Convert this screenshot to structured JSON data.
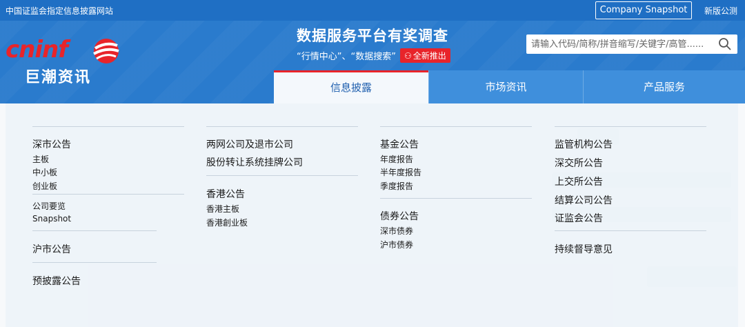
{
  "topbar": {
    "site_note": "中国证监会指定信息披露网站",
    "snapshot_label": "Company Snapshot",
    "new_announce": "新版公测"
  },
  "logo": {
    "word": "cninf",
    "sub": "巨潮资讯"
  },
  "promo": {
    "title": "数据服务平台有奖调查",
    "subtitle": "“行情中心”、“数据搜索”",
    "badge": "全新推出"
  },
  "search": {
    "placeholder": "请输入代码/简称/拼音缩写/关键字/高管......"
  },
  "nav": {
    "tabs": [
      {
        "label": "信息披露"
      },
      {
        "label": "市场资讯"
      },
      {
        "label": "产品服务"
      }
    ]
  },
  "menu": {
    "col1": {
      "shenshi": "深市公告",
      "items": [
        "主板",
        "中小板",
        "创业板"
      ],
      "items2": [
        "公司要览",
        "Snapshot"
      ],
      "hushi": "沪市公告",
      "yupilu": "预披露公告"
    },
    "col2": {
      "liangwang": "两网公司及退市公司",
      "gufen": "股份转让系统挂牌公司",
      "xianggang": "香港公告",
      "items": [
        "香港主板",
        "香港創业板"
      ]
    },
    "col3": {
      "jijin": "基金公告",
      "items": [
        "年度报告",
        "半年度报告",
        "季度报告"
      ],
      "zhaiquan": "债券公告",
      "items2": [
        "深市债券",
        "沪市债券"
      ]
    },
    "col4": {
      "items": [
        "监管机构公告",
        "深交所公告",
        "上交所公告",
        "结算公司公告",
        "证监会公告"
      ],
      "chixu": "持续督导意见"
    }
  },
  "colors": {
    "primary": "#2a7bcd",
    "accent": "#e8242a"
  }
}
